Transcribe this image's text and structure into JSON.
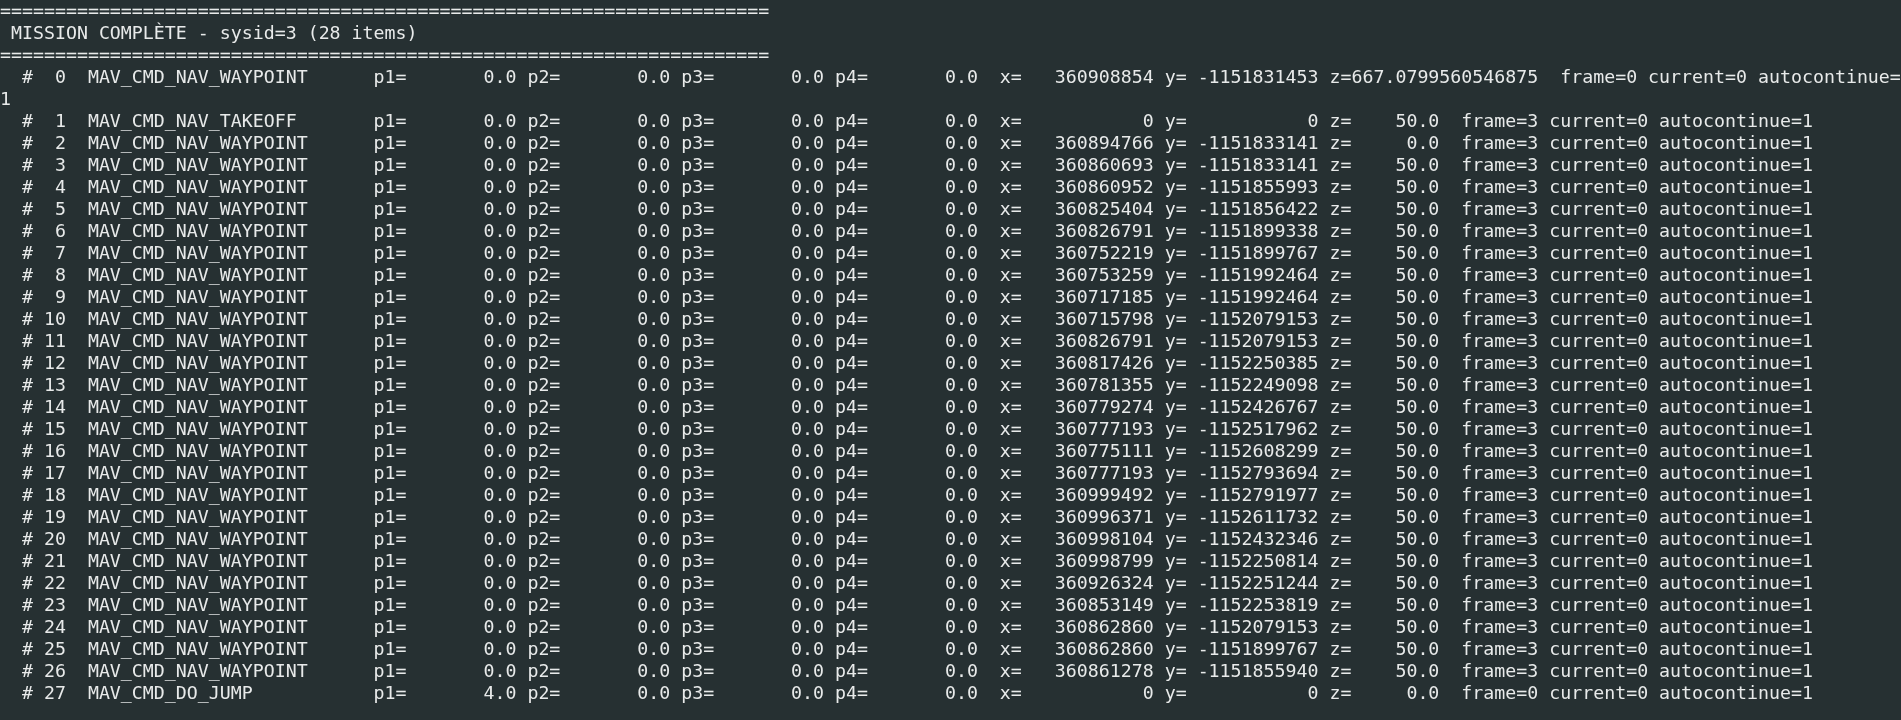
{
  "terminal": {
    "rule_top": "======================================================================",
    "title": " MISSION COMPLÈTE - sysid=3 (28 items)",
    "rule_bottom": "======================================================================",
    "lines": [
      "  #  0  MAV_CMD_NAV_WAYPOINT      p1=       0.0 p2=       0.0 p3=       0.0 p4=       0.0  x=   360908854 y= -1151831453 z=667.0799560546875  frame=0 current=0 autocontinue=",
      "1",
      "  #  1  MAV_CMD_NAV_TAKEOFF       p1=       0.0 p2=       0.0 p3=       0.0 p4=       0.0  x=           0 y=           0 z=    50.0  frame=3 current=0 autocontinue=1",
      "  #  2  MAV_CMD_NAV_WAYPOINT      p1=       0.0 p2=       0.0 p3=       0.0 p4=       0.0  x=   360894766 y= -1151833141 z=     0.0  frame=3 current=0 autocontinue=1",
      "  #  3  MAV_CMD_NAV_WAYPOINT      p1=       0.0 p2=       0.0 p3=       0.0 p4=       0.0  x=   360860693 y= -1151833141 z=    50.0  frame=3 current=0 autocontinue=1",
      "  #  4  MAV_CMD_NAV_WAYPOINT      p1=       0.0 p2=       0.0 p3=       0.0 p4=       0.0  x=   360860952 y= -1151855993 z=    50.0  frame=3 current=0 autocontinue=1",
      "  #  5  MAV_CMD_NAV_WAYPOINT      p1=       0.0 p2=       0.0 p3=       0.0 p4=       0.0  x=   360825404 y= -1151856422 z=    50.0  frame=3 current=0 autocontinue=1",
      "  #  6  MAV_CMD_NAV_WAYPOINT      p1=       0.0 p2=       0.0 p3=       0.0 p4=       0.0  x=   360826791 y= -1151899338 z=    50.0  frame=3 current=0 autocontinue=1",
      "  #  7  MAV_CMD_NAV_WAYPOINT      p1=       0.0 p2=       0.0 p3=       0.0 p4=       0.0  x=   360752219 y= -1151899767 z=    50.0  frame=3 current=0 autocontinue=1",
      "  #  8  MAV_CMD_NAV_WAYPOINT      p1=       0.0 p2=       0.0 p3=       0.0 p4=       0.0  x=   360753259 y= -1151992464 z=    50.0  frame=3 current=0 autocontinue=1",
      "  #  9  MAV_CMD_NAV_WAYPOINT      p1=       0.0 p2=       0.0 p3=       0.0 p4=       0.0  x=   360717185 y= -1151992464 z=    50.0  frame=3 current=0 autocontinue=1",
      "  # 10  MAV_CMD_NAV_WAYPOINT      p1=       0.0 p2=       0.0 p3=       0.0 p4=       0.0  x=   360715798 y= -1152079153 z=    50.0  frame=3 current=0 autocontinue=1",
      "  # 11  MAV_CMD_NAV_WAYPOINT      p1=       0.0 p2=       0.0 p3=       0.0 p4=       0.0  x=   360826791 y= -1152079153 z=    50.0  frame=3 current=0 autocontinue=1",
      "  # 12  MAV_CMD_NAV_WAYPOINT      p1=       0.0 p2=       0.0 p3=       0.0 p4=       0.0  x=   360817426 y= -1152250385 z=    50.0  frame=3 current=0 autocontinue=1",
      "  # 13  MAV_CMD_NAV_WAYPOINT      p1=       0.0 p2=       0.0 p3=       0.0 p4=       0.0  x=   360781355 y= -1152249098 z=    50.0  frame=3 current=0 autocontinue=1",
      "  # 14  MAV_CMD_NAV_WAYPOINT      p1=       0.0 p2=       0.0 p3=       0.0 p4=       0.0  x=   360779274 y= -1152426767 z=    50.0  frame=3 current=0 autocontinue=1",
      "  # 15  MAV_CMD_NAV_WAYPOINT      p1=       0.0 p2=       0.0 p3=       0.0 p4=       0.0  x=   360777193 y= -1152517962 z=    50.0  frame=3 current=0 autocontinue=1",
      "  # 16  MAV_CMD_NAV_WAYPOINT      p1=       0.0 p2=       0.0 p3=       0.0 p4=       0.0  x=   360775111 y= -1152608299 z=    50.0  frame=3 current=0 autocontinue=1",
      "  # 17  MAV_CMD_NAV_WAYPOINT      p1=       0.0 p2=       0.0 p3=       0.0 p4=       0.0  x=   360777193 y= -1152793694 z=    50.0  frame=3 current=0 autocontinue=1",
      "  # 18  MAV_CMD_NAV_WAYPOINT      p1=       0.0 p2=       0.0 p3=       0.0 p4=       0.0  x=   360999492 y= -1152791977 z=    50.0  frame=3 current=0 autocontinue=1",
      "  # 19  MAV_CMD_NAV_WAYPOINT      p1=       0.0 p2=       0.0 p3=       0.0 p4=       0.0  x=   360996371 y= -1152611732 z=    50.0  frame=3 current=0 autocontinue=1",
      "  # 20  MAV_CMD_NAV_WAYPOINT      p1=       0.0 p2=       0.0 p3=       0.0 p4=       0.0  x=   360998104 y= -1152432346 z=    50.0  frame=3 current=0 autocontinue=1",
      "  # 21  MAV_CMD_NAV_WAYPOINT      p1=       0.0 p2=       0.0 p3=       0.0 p4=       0.0  x=   360998799 y= -1152250814 z=    50.0  frame=3 current=0 autocontinue=1",
      "  # 22  MAV_CMD_NAV_WAYPOINT      p1=       0.0 p2=       0.0 p3=       0.0 p4=       0.0  x=   360926324 y= -1152251244 z=    50.0  frame=3 current=0 autocontinue=1",
      "  # 23  MAV_CMD_NAV_WAYPOINT      p1=       0.0 p2=       0.0 p3=       0.0 p4=       0.0  x=   360853149 y= -1152253819 z=    50.0  frame=3 current=0 autocontinue=1",
      "  # 24  MAV_CMD_NAV_WAYPOINT      p1=       0.0 p2=       0.0 p3=       0.0 p4=       0.0  x=   360862860 y= -1152079153 z=    50.0  frame=3 current=0 autocontinue=1",
      "  # 25  MAV_CMD_NAV_WAYPOINT      p1=       0.0 p2=       0.0 p3=       0.0 p4=       0.0  x=   360862860 y= -1151899767 z=    50.0  frame=3 current=0 autocontinue=1",
      "  # 26  MAV_CMD_NAV_WAYPOINT      p1=       0.0 p2=       0.0 p3=       0.0 p4=       0.0  x=   360861278 y= -1151855940 z=    50.0  frame=3 current=0 autocontinue=1",
      "  # 27  MAV_CMD_DO_JUMP           p1=       4.0 p2=       0.0 p3=       0.0 p4=       0.0  x=           0 y=           0 z=     0.0  frame=0 current=0 autocontinue=1"
    ]
  }
}
